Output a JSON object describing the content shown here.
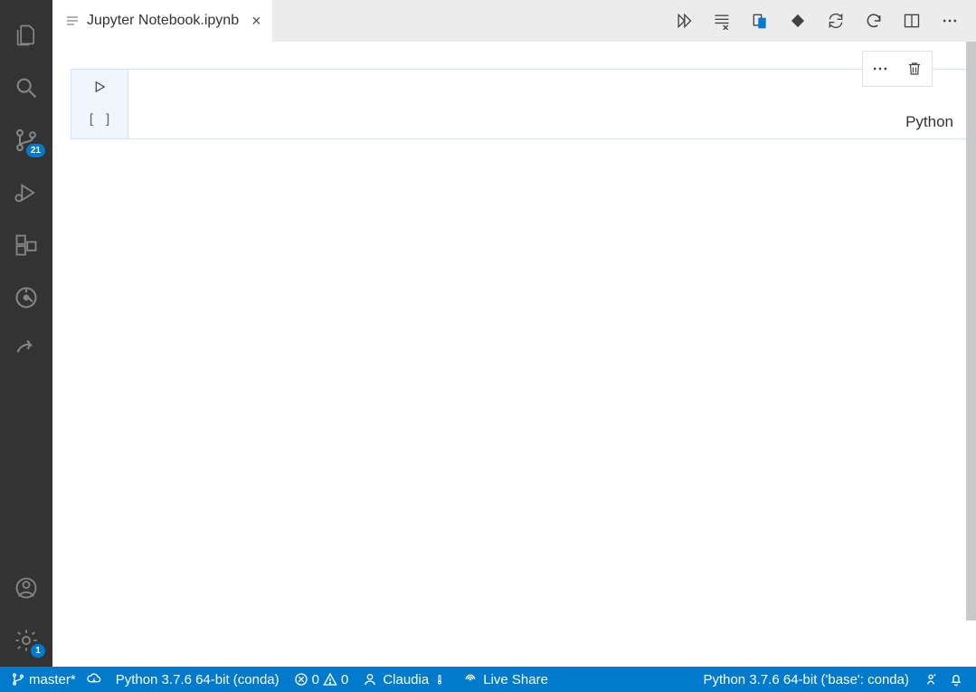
{
  "tab": {
    "title": "Jupyter Notebook.ipynb"
  },
  "activity": {
    "source_control_badge": "21",
    "settings_badge": "1"
  },
  "cell": {
    "exec_label": "[  ]",
    "language": "Python"
  },
  "status": {
    "branch": "master*",
    "interpreter": "Python 3.7.6 64-bit (conda)",
    "errors": "0",
    "warnings": "0",
    "user": "Claudia",
    "live_share": "Live Share",
    "kernel": "Python 3.7.6 64-bit ('base': conda)"
  }
}
